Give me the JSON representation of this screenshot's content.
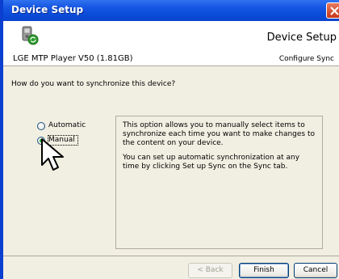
{
  "window": {
    "title": "Device Setup"
  },
  "header": {
    "title": "Device Setup",
    "device": "LGE MTP Player V50 (1.81GB)",
    "subtitle": "Configure Sync"
  },
  "question": "How do you want to synchronize this device?",
  "options": [
    {
      "label": "Automatic",
      "selected": false
    },
    {
      "label": "Manual",
      "selected": true
    }
  ],
  "info": {
    "paragraph1": "This option allows you to manually select items to synchronize each time you want to make changes to the content on your device.",
    "paragraph2": "You can set up automatic synchronization at any time by clicking Set up Sync on the Sync tab."
  },
  "buttons": {
    "back": "< Back",
    "finish": "Finish",
    "cancel": "Cancel"
  },
  "colors": {
    "titlebar": "#0b4bd9",
    "radio_selected": "#21a121",
    "dialog_bg": "#f1efe2"
  }
}
